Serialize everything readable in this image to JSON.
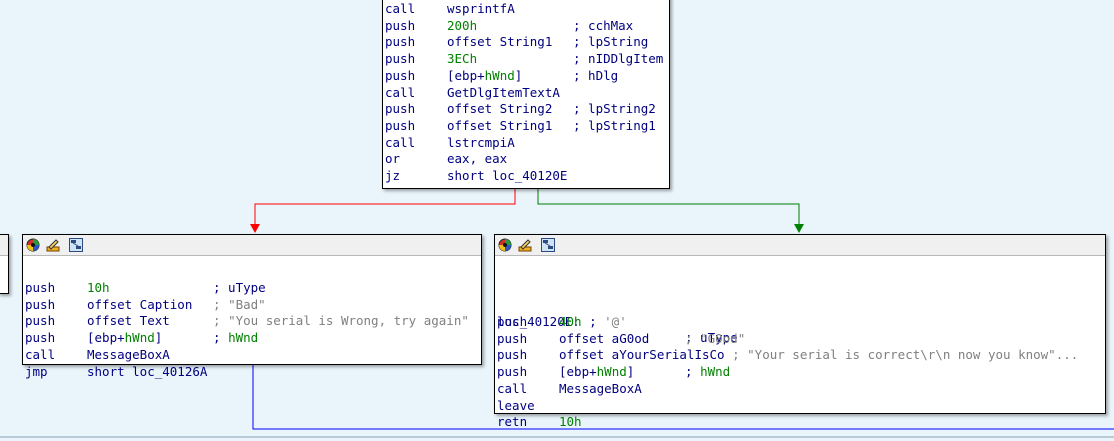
{
  "graph": {
    "top_block": {
      "lines": [
        {
          "mnemonic": "call",
          "operand_parts": [
            {
              "t": "wsprintfA",
              "c": ""
            }
          ],
          "comment_parts": []
        },
        {
          "mnemonic": "push",
          "operand_parts": [
            {
              "t": "200h",
              "c": "num"
            }
          ],
          "comment_parts": [
            {
              "t": "; cchMax",
              "c": ""
            }
          ]
        },
        {
          "mnemonic": "push",
          "operand_parts": [
            {
              "t": "offset String1",
              "c": ""
            }
          ],
          "comment_parts": [
            {
              "t": "; lpString",
              "c": ""
            }
          ]
        },
        {
          "mnemonic": "push",
          "operand_parts": [
            {
              "t": "3ECh",
              "c": "num"
            }
          ],
          "comment_parts": [
            {
              "t": "; nIDDlgItem",
              "c": ""
            }
          ]
        },
        {
          "mnemonic": "push",
          "operand_parts": [
            {
              "t": "[ebp+",
              "c": ""
            },
            {
              "t": "hWnd",
              "c": "num"
            },
            {
              "t": "]",
              "c": ""
            }
          ],
          "comment_parts": [
            {
              "t": "; hDlg",
              "c": ""
            }
          ]
        },
        {
          "mnemonic": "call",
          "operand_parts": [
            {
              "t": "GetDlgItemTextA",
              "c": ""
            }
          ],
          "comment_parts": []
        },
        {
          "mnemonic": "push",
          "operand_parts": [
            {
              "t": "offset String2",
              "c": ""
            }
          ],
          "comment_parts": [
            {
              "t": "; lpString2",
              "c": ""
            }
          ]
        },
        {
          "mnemonic": "push",
          "operand_parts": [
            {
              "t": "offset String1",
              "c": ""
            }
          ],
          "comment_parts": [
            {
              "t": "; lpString1",
              "c": ""
            }
          ]
        },
        {
          "mnemonic": "call",
          "operand_parts": [
            {
              "t": "lstrcmpiA",
              "c": ""
            }
          ],
          "comment_parts": []
        },
        {
          "mnemonic": "or",
          "operand_parts": [
            {
              "t": "eax, eax",
              "c": ""
            }
          ],
          "comment_parts": []
        },
        {
          "mnemonic": "jz",
          "operand_parts": [
            {
              "t": "short loc_40120E",
              "c": ""
            }
          ],
          "comment_parts": []
        }
      ]
    },
    "bad_block": {
      "lines": [
        {
          "mnemonic": "push",
          "operand_parts": [
            {
              "t": "10h",
              "c": "num"
            }
          ],
          "comment_parts": [
            {
              "t": "; uType",
              "c": ""
            }
          ]
        },
        {
          "mnemonic": "push",
          "operand_parts": [
            {
              "t": "offset Caption",
              "c": ""
            }
          ],
          "comment_parts": [
            {
              "t": "; ",
              "c": "str"
            },
            {
              "t": "\"Bad\"",
              "c": "str"
            }
          ]
        },
        {
          "mnemonic": "push",
          "operand_parts": [
            {
              "t": "offset Text",
              "c": ""
            }
          ],
          "comment_parts": [
            {
              "t": "; ",
              "c": "str"
            },
            {
              "t": "\"You serial is Wrong, try again\"",
              "c": "str"
            }
          ]
        },
        {
          "mnemonic": "push",
          "operand_parts": [
            {
              "t": "[ebp+",
              "c": ""
            },
            {
              "t": "hWnd",
              "c": "num"
            },
            {
              "t": "]",
              "c": ""
            }
          ],
          "comment_parts": [
            {
              "t": "; ",
              "c": ""
            },
            {
              "t": "hWnd",
              "c": "num"
            }
          ]
        },
        {
          "mnemonic": "call",
          "operand_parts": [
            {
              "t": "MessageBoxA",
              "c": ""
            }
          ],
          "comment_parts": []
        },
        {
          "mnemonic": "jmp",
          "operand_parts": [
            {
              "t": "short loc_40126A",
              "c": ""
            }
          ],
          "comment_parts": []
        }
      ]
    },
    "good_block": {
      "label": "loc_40120E:",
      "label_comment": "; uType",
      "lines": [
        {
          "mnemonic": "push",
          "operand_parts": [
            {
              "t": "40h",
              "c": "num"
            },
            {
              "t": " ; ",
              "c": ""
            },
            {
              "t": "'@'",
              "c": "str"
            }
          ],
          "comment_parts": []
        },
        {
          "mnemonic": "push",
          "operand_parts": [
            {
              "t": "offset aG0od",
              "c": ""
            }
          ],
          "comment_parts": [
            {
              "t": "; ",
              "c": "str"
            },
            {
              "t": "\"G0od\"",
              "c": "str"
            }
          ]
        },
        {
          "mnemonic": "push",
          "operand_parts": [
            {
              "t": "offset aYourSerialIsCo",
              "c": ""
            },
            {
              "t": " ; ",
              "c": "str"
            },
            {
              "t": "\"Your serial is correct\\r\\n now you know\"...",
              "c": "str"
            }
          ],
          "comment_parts": []
        },
        {
          "mnemonic": "push",
          "operand_parts": [
            {
              "t": "[ebp+",
              "c": ""
            },
            {
              "t": "hWnd",
              "c": "num"
            },
            {
              "t": "]",
              "c": ""
            }
          ],
          "comment_parts": [
            {
              "t": "; ",
              "c": ""
            },
            {
              "t": "hWnd",
              "c": "num"
            }
          ]
        },
        {
          "mnemonic": "call",
          "operand_parts": [
            {
              "t": "MessageBoxA",
              "c": ""
            }
          ],
          "comment_parts": []
        },
        {
          "mnemonic": "leave",
          "operand_parts": [],
          "comment_parts": []
        },
        {
          "mnemonic": "retn",
          "operand_parts": [
            {
              "t": "10h",
              "c": "num"
            }
          ],
          "comment_parts": []
        }
      ]
    },
    "edges": [
      {
        "name": "edge-false",
        "color": "#ff0000"
      },
      {
        "name": "edge-true",
        "color": "#008000"
      },
      {
        "name": "edge-jmp",
        "color": "#0000ff"
      }
    ],
    "header_icons": [
      "node-color-icon",
      "rename-node-icon",
      "graph-overview-icon"
    ],
    "colors": {
      "background": "#e9f4fb",
      "code": "#000080",
      "number": "#008000",
      "string_comment": "#808080"
    }
  }
}
